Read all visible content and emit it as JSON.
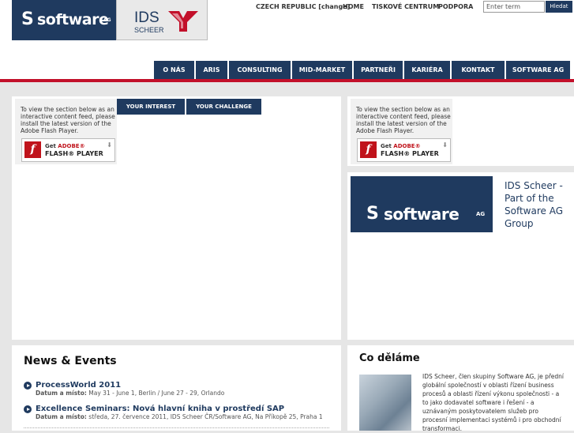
{
  "header": {
    "logo_sag": {
      "mark": "S",
      "word": "software",
      "ag": "AG"
    },
    "logo_ids": {
      "ids": "IDS",
      "scheer": "SCHEER"
    },
    "topnav": {
      "country": "CZECH REPUBLIC [change]",
      "home": "HOME",
      "press": "TISKOVÉ CENTRUM",
      "support": "PODPORA"
    },
    "search": {
      "placeholder": "Enter term",
      "button": "Hledat"
    }
  },
  "mainnav": [
    "O NÁS",
    "ARIS",
    "CONSULTING",
    "MID-MARKET",
    "PARTNEŘI",
    "KARIÉRA",
    "KONTAKT",
    "SOFTWARE AG"
  ],
  "flash": {
    "text": "To view the section below as an interactive content feed, please install the latest version of the Adobe Flash Player.",
    "get": "Get ",
    "adobe": "ADOBE®",
    "player": "FLASH® PLAYER",
    "icon": "f"
  },
  "tabs": {
    "interest": "YOUR INTEREST",
    "challenge": "YOUR CHALLENGE"
  },
  "banner": {
    "mark": "S",
    "word": "software",
    "ag": "AG",
    "caption": "IDS Scheer - Part of the Software AG Group"
  },
  "news": {
    "title": "News & Events",
    "meta_label": "Datum a místo:",
    "items": [
      {
        "title": "ProcessWorld 2011",
        "meta": "May 31 - June 1, Berlin / June 27 - 29, Orlando"
      },
      {
        "title": "Excellence Seminars: Nová hlavní kniha v prostředí SAP",
        "meta": "středa, 27. července 2011, IDS Scheer ČR/Software AG, Na Příkopě 25, Praha 1"
      }
    ]
  },
  "what_we_do": {
    "title": "Co děláme",
    "text": "IDS Scheer, člen skupiny Software AG, je přední globální společností v oblasti řízení business procesů a oblasti řízení výkonu společnosti - a to jako dodavatel software i řešení - a uznávaným poskytovatelem služeb pro procesní implementaci systémů i pro obchodní transformaci."
  },
  "colors": {
    "brand": "#1f3a5f",
    "accent": "#c2102a"
  }
}
